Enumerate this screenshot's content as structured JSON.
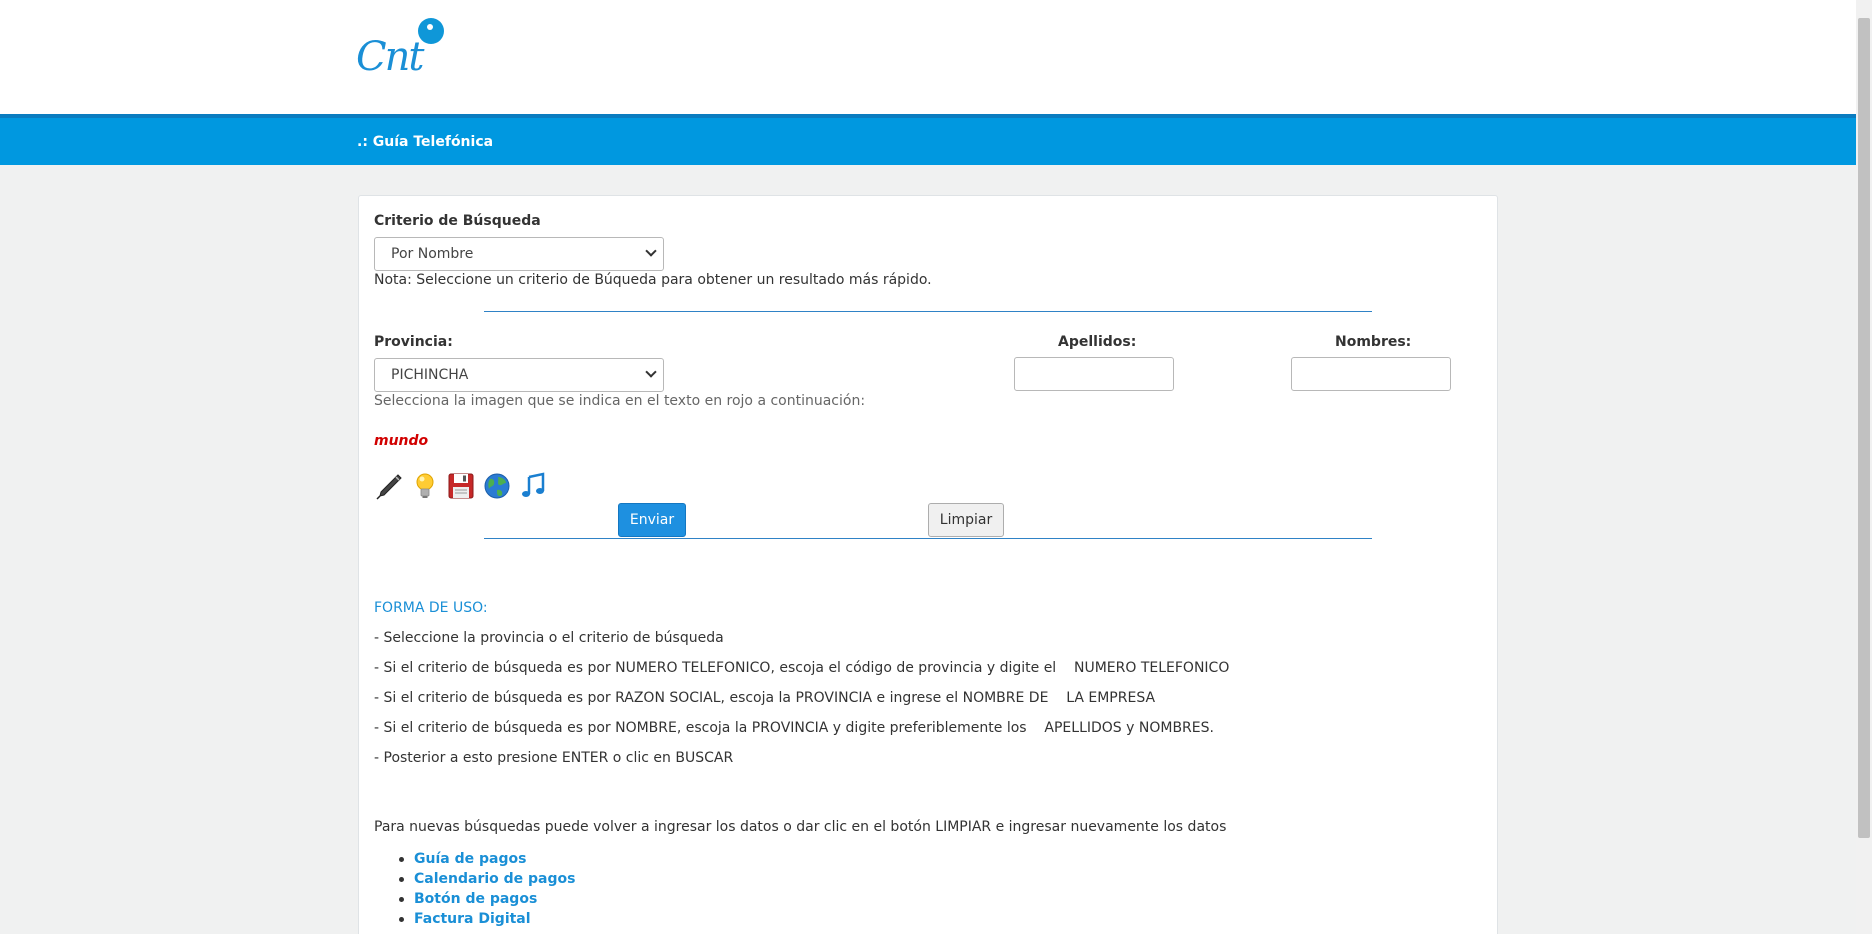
{
  "header": {
    "logo_text": "Cnt",
    "section_title": ".: Guía Telefónica"
  },
  "form": {
    "criterio_label": "Criterio de Búsqueda",
    "criterio_value": "Por Nombre",
    "nota": "Nota: Seleccione un criterio de Búqueda para obtener un resultado más rápido.",
    "provincia_label": "Provincia:",
    "provincia_value": "PICHINCHA",
    "apellidos_label": "Apellidos:",
    "nombres_label": "Nombres:",
    "captcha_instruction": "Selecciona la imagen que se indica en el texto en rojo a continuación:",
    "captcha_word": "mundo",
    "captcha_icons": [
      "pen-icon",
      "lightbulb-icon",
      "floppy-disk-icon",
      "globe-icon",
      "music-note-icon"
    ],
    "enviar_label": "Enviar",
    "limpiar_label": "Limpiar"
  },
  "instructions": {
    "title": "FORMA DE USO:",
    "lines": [
      "- Seleccione la provincia o el criterio de búsqueda",
      "- Si el criterio de búsqueda es por NUMERO TELEFONICO, escoja el código de provincia y digite el    NUMERO TELEFONICO",
      "- Si el criterio de búsqueda es por RAZON SOCIAL, escoja la PROVINCIA e ingrese el NOMBRE DE    LA EMPRESA",
      "- Si el criterio de búsqueda es por NOMBRE, escoja la PROVINCIA y digite preferiblemente los    APELLIDOS y NOMBRES.",
      "- Posterior a esto presione ENTER o clic en BUSCAR"
    ],
    "note": "Para nuevas búsquedas puede volver a ingresar los datos o dar clic en el botón LIMPIAR e ingresar nuevamente los datos"
  },
  "links": [
    "Guía de pagos",
    "Calendario de pagos",
    "Botón de pagos",
    "Factura Digital"
  ],
  "colors": {
    "brand_blue": "#0098e0",
    "link_blue": "#1a8fd6",
    "captcha_red": "#d10000"
  }
}
